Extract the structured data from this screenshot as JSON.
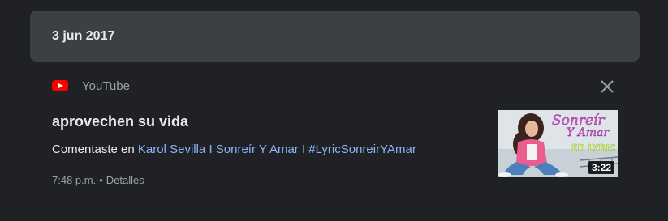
{
  "date_header": "3 jun 2017",
  "activity": {
    "service_name": "YouTube",
    "service_icon": "youtube-icon",
    "title": "aprovechen su vida",
    "comment_prefix": "Comentaste en ",
    "video_link": "Karol Sevilla I Sonreír Y Amar I #LyricSonreirYAmar",
    "time": "7:48 p.m.",
    "separator": "•",
    "details_label": "Detalles",
    "thumbnail": {
      "overlay_text_1": "Sonreír",
      "overlay_text_2": "Y Amar",
      "overlay_text_3": "ED LYRIC",
      "duration": "3:22"
    }
  },
  "colors": {
    "background": "#202124",
    "header_bg": "#3c4043",
    "primary_text": "#e8eaed",
    "secondary_text": "#9aa0a6",
    "link": "#8ab4f8",
    "youtube_red": "#ff0000"
  }
}
